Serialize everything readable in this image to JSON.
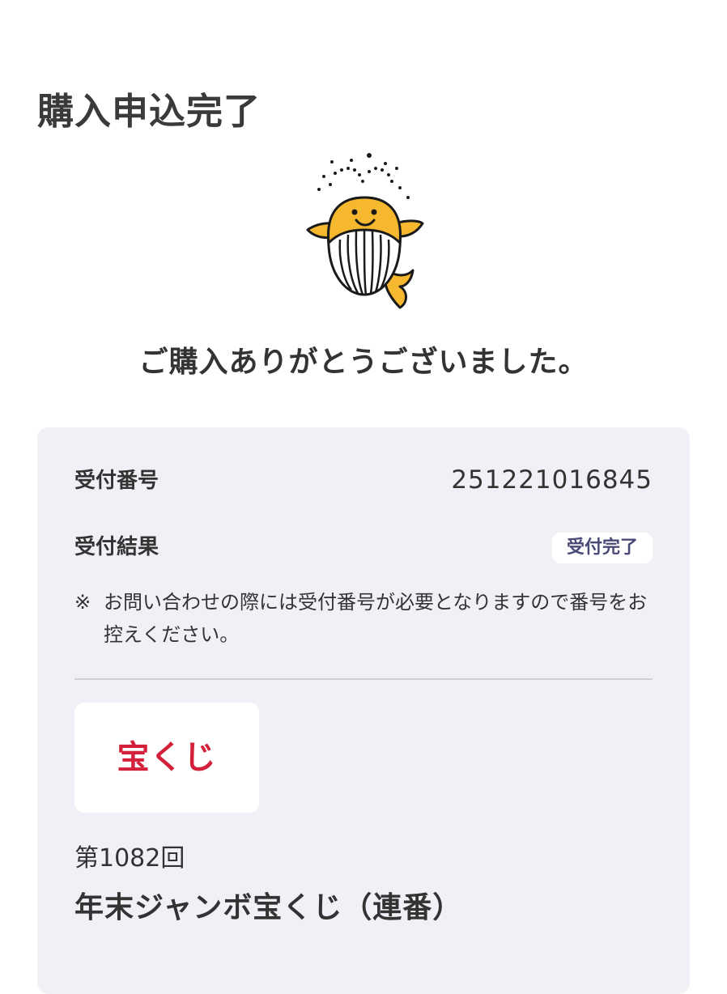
{
  "header": {
    "title": "購入申込完了"
  },
  "mascot": {
    "icon": "whale-mascot-icon",
    "body_color": "#f5b82e"
  },
  "message": {
    "thanks": "ご購入ありがとうございました。"
  },
  "receipt": {
    "number_label": "受付番号",
    "number_value": "251221016845",
    "result_label": "受付結果",
    "result_badge": "受付完了",
    "note_mark": "※",
    "note_text": "お問い合わせの際には受付番号が必要となりますので番号をお控えください。"
  },
  "product": {
    "logo_text": "宝くじ",
    "logo_color": "#d4213b",
    "draw_number": "第1082回",
    "name": "年末ジャンボ宝くじ（連番）"
  },
  "colors": {
    "card_background": "#f0f1f6",
    "badge_text": "#4a4a78"
  }
}
